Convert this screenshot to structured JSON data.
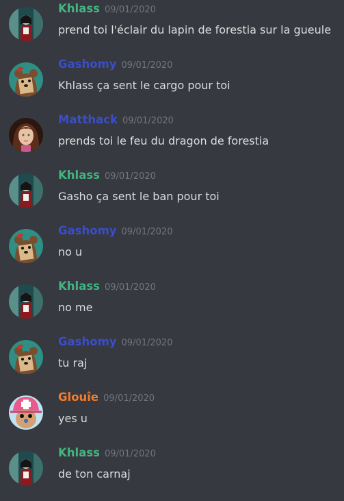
{
  "colors": {
    "background": "#36393f",
    "text": "#dcddde",
    "timestamp": "#72767d",
    "green": "#43b581",
    "blue": "#3b4dc8",
    "orange": "#f47b2b"
  },
  "messages": [
    {
      "username": "Khlass",
      "color": "#43b581",
      "avatar": "khlass-avatar",
      "timestamp": "09/01/2020",
      "text": "prend toi l'éclair du lapin de forestia sur la gueule"
    },
    {
      "username": "Gashomy",
      "color": "#3b4dc8",
      "avatar": "gashomy-avatar",
      "timestamp": "09/01/2020",
      "text": "Khlass ça sent le cargo pour toi"
    },
    {
      "username": "Matthack",
      "color": "#3b4dc8",
      "avatar": "matthack-avatar",
      "timestamp": "09/01/2020",
      "text": "prends toi le feu du dragon de forestia"
    },
    {
      "username": "Khlass",
      "color": "#43b581",
      "avatar": "khlass-avatar",
      "timestamp": "09/01/2020",
      "text": "Gasho ça sent le ban pour toi"
    },
    {
      "username": "Gashomy",
      "color": "#3b4dc8",
      "avatar": "gashomy-avatar",
      "timestamp": "09/01/2020",
      "text": "no u"
    },
    {
      "username": "Khlass",
      "color": "#43b581",
      "avatar": "khlass-avatar",
      "timestamp": "09/01/2020",
      "text": "no me"
    },
    {
      "username": "Gashomy",
      "color": "#3b4dc8",
      "avatar": "gashomy-avatar",
      "timestamp": "09/01/2020",
      "text": "tu raj"
    },
    {
      "username": "Glouîe",
      "color": "#f47b2b",
      "avatar": "glouie-avatar",
      "timestamp": "09/01/2020",
      "text": "yes u"
    },
    {
      "username": "Khlass",
      "color": "#43b581",
      "avatar": "khlass-avatar",
      "timestamp": "09/01/2020",
      "text": "de ton carnaj"
    }
  ]
}
